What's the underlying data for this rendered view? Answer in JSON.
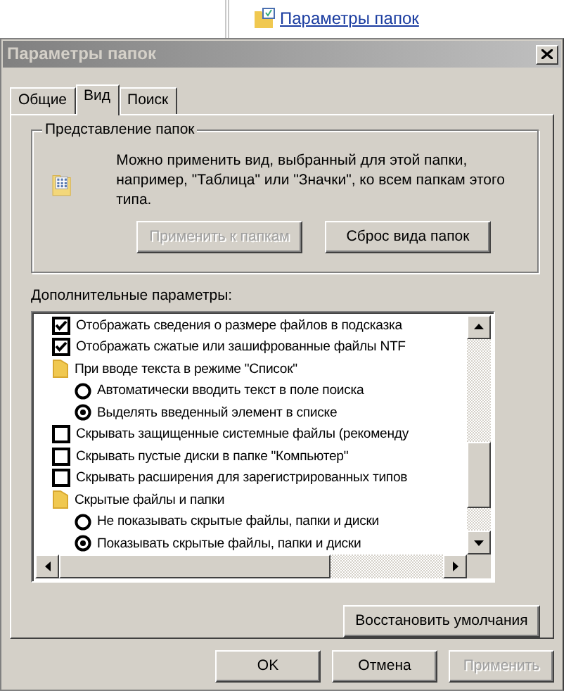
{
  "top_link": {
    "label": "Параметры папок"
  },
  "window": {
    "title": "Параметры папок"
  },
  "tabs": [
    {
      "label": "Общие",
      "selected": false
    },
    {
      "label": "Вид",
      "selected": true
    },
    {
      "label": "Поиск",
      "selected": false
    }
  ],
  "folder_views": {
    "title": "Представление папок",
    "description": "Можно применить вид, выбранный для этой папки, например, \"Таблица\" или \"Значки\", ко всем папкам этого типа.",
    "buttons": [
      {
        "label": "Применить к папкам",
        "disabled": true
      },
      {
        "label": "Сброс вида папок",
        "disabled": false
      }
    ]
  },
  "advanced": {
    "label": "Дополнительные параметры:",
    "items": [
      {
        "kind": "checkbox",
        "label": "Отображать сведения о размере файлов в подсказка",
        "checked": true
      },
      {
        "kind": "checkbox",
        "label": "Отображать сжатые или зашифрованные файлы NTF",
        "checked": true
      },
      {
        "kind": "group",
        "label": "При вводе текста в режиме \"Список\"",
        "children": [
          {
            "kind": "radio",
            "label": "Автоматически вводить текст в поле поиска",
            "checked": false
          },
          {
            "kind": "radio",
            "label": "Выделять введенный элемент в списке",
            "checked": true
          }
        ]
      },
      {
        "kind": "checkbox",
        "label": "Скрывать защищенные системные файлы (рекоменду",
        "checked": false
      },
      {
        "kind": "checkbox",
        "label": "Скрывать пустые диски в папке \"Компьютер\"",
        "checked": false
      },
      {
        "kind": "checkbox",
        "label": "Скрывать расширения для зарегистрированных типов",
        "checked": false
      },
      {
        "kind": "group",
        "label": "Скрытые файлы и папки",
        "children": [
          {
            "kind": "radio",
            "label": "Не показывать скрытые файлы, папки и диски",
            "checked": false
          },
          {
            "kind": "radio",
            "label": "Показывать скрытые файлы, папки и диски",
            "checked": true
          }
        ]
      }
    ]
  },
  "restore_button": {
    "label": "Восстановить умолчания"
  },
  "buttons": [
    {
      "label": "OK",
      "disabled": false
    },
    {
      "label": "Отмена",
      "disabled": false
    },
    {
      "label": "Применить",
      "disabled": true
    }
  ]
}
